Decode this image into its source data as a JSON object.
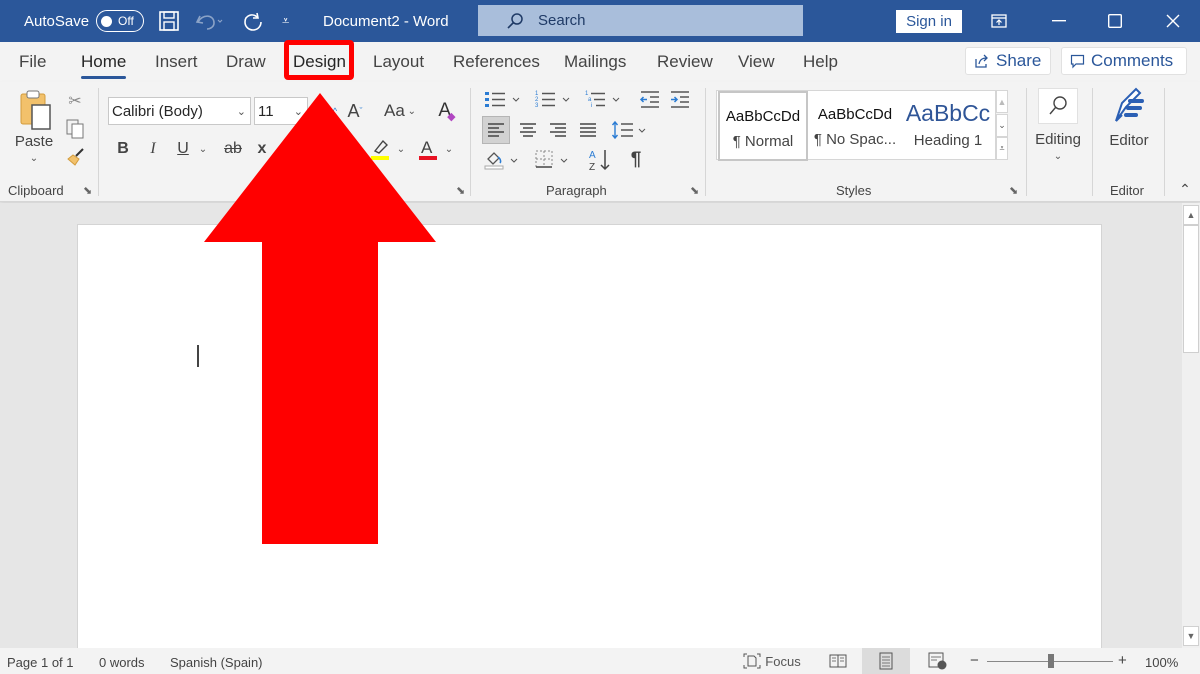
{
  "titlebar": {
    "autosave_label": "AutoSave",
    "autosave_state": "Off",
    "document_title": "Document2  -  Word",
    "search_placeholder": "Search",
    "signin_label": "Sign in"
  },
  "tabs": [
    {
      "label": "File"
    },
    {
      "label": "Home",
      "active": true
    },
    {
      "label": "Insert"
    },
    {
      "label": "Draw"
    },
    {
      "label": "Design",
      "highlighted": true
    },
    {
      "label": "Layout"
    },
    {
      "label": "References"
    },
    {
      "label": "Mailings"
    },
    {
      "label": "Review"
    },
    {
      "label": "View"
    },
    {
      "label": "Help"
    }
  ],
  "actions": {
    "share_label": "Share",
    "comments_label": "Comments"
  },
  "ribbon": {
    "clipboard": {
      "label": "Clipboard",
      "paste_label": "Paste"
    },
    "font": {
      "font_name": "Calibri (Body)",
      "font_size": "11",
      "change_case": "Aa"
    },
    "paragraph": {
      "label": "Paragraph"
    },
    "styles": {
      "label": "Styles",
      "items": [
        {
          "preview": "AaBbCcDd",
          "name": "¶ Normal"
        },
        {
          "preview": "AaBbCcDd",
          "name": "¶ No Spac..."
        },
        {
          "preview": "AaBbCc",
          "name": "Heading 1"
        }
      ]
    },
    "editing": {
      "label": "Editing"
    },
    "editor": {
      "button_label": "Editor",
      "label": "Editor"
    }
  },
  "status": {
    "page": "Page 1 of 1",
    "words": "0 words",
    "language": "Spanish (Spain)",
    "focus_label": "Focus",
    "zoom_level": "100%",
    "zoom_percent": 100
  },
  "annotation": {
    "color": "#ff0000",
    "target": "Design"
  },
  "colors": {
    "brand": "#2b579a",
    "highlight": "#ffff00",
    "font_color": "#e81123"
  }
}
